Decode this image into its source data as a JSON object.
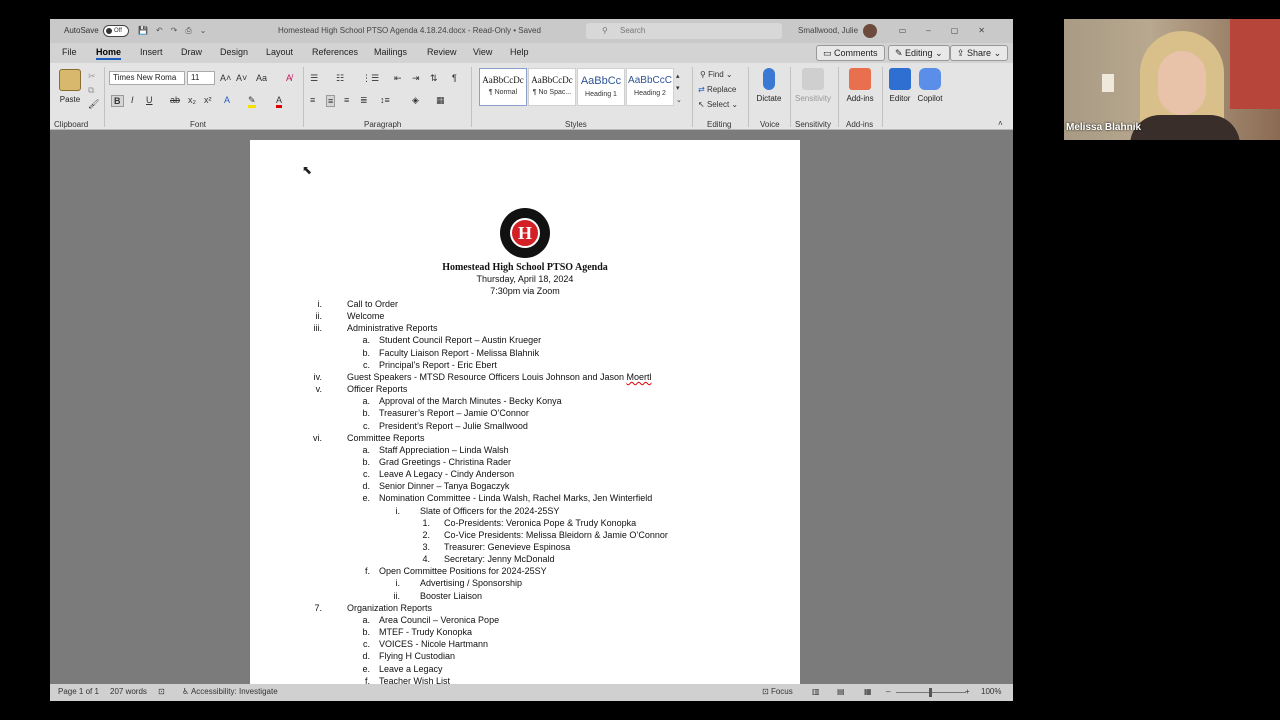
{
  "titlebar": {
    "autosave_label": "AutoSave",
    "autosave_state": "Off",
    "doc_title": "Homestead High School PTSO Agenda 4.18.24.docx  -  Read-Only  •  Saved",
    "search_placeholder": "Search",
    "user_name": "Smallwood, Julie"
  },
  "menu": {
    "tabs": [
      "File",
      "Home",
      "Insert",
      "Draw",
      "Design",
      "Layout",
      "References",
      "Mailings",
      "Review",
      "View",
      "Help"
    ],
    "comments": "Comments",
    "editing": "Editing",
    "share": "Share"
  },
  "ribbon": {
    "paste": "Paste",
    "font_name": "Times New Roma",
    "font_size": "11",
    "styles": [
      {
        "preview": "AaBbCcDc",
        "name": "¶ Normal"
      },
      {
        "preview": "AaBbCcDc",
        "name": "¶ No Spac..."
      },
      {
        "preview": "AaBbCc",
        "name": "Heading 1"
      },
      {
        "preview": "AaBbCcC",
        "name": "Heading 2"
      }
    ],
    "find": "Find",
    "replace": "Replace",
    "select": "Select",
    "dictate": "Dictate",
    "sensitivity": "Sensitivity",
    "addins": "Add-ins",
    "editor": "Editor",
    "copilot": "Copilot",
    "groups": {
      "clipboard": "Clipboard",
      "font": "Font",
      "paragraph": "Paragraph",
      "styles": "Styles",
      "editing": "Editing",
      "voice": "Voice",
      "sensitivity": "Sensitivity",
      "addins": "Add-ins"
    }
  },
  "doc": {
    "logo_letter": "H",
    "title": "Homestead High School PTSO Agenda",
    "date": "Thursday, April 18, 2024",
    "time": "7:30pm via Zoom",
    "items": [
      {
        "n": "i.",
        "t": "Call to Order"
      },
      {
        "n": "ii.",
        "t": "Welcome"
      },
      {
        "n": "iii.",
        "t": "Administrative Reports"
      },
      {
        "n": "a.",
        "t": "Student Council Report – Austin Krueger"
      },
      {
        "n": "b.",
        "t": "Faculty Liaison Report - Melissa Blahnik"
      },
      {
        "n": "c.",
        "t": "Principal’s Report - Eric Ebert"
      },
      {
        "n": "iv.",
        "t": "Guest Speakers - MTSD Resource Officers Louis Johnson and Jason ",
        "t2": "Moertl"
      },
      {
        "n": "v.",
        "t": "Officer Reports"
      },
      {
        "n": "a.",
        "t": "Approval of the March Minutes - Becky Konya"
      },
      {
        "n": "b.",
        "t": "Treasurer’s Report – Jamie O’Connor"
      },
      {
        "n": "c.",
        "t": "President’s Report – Julie Smallwood"
      },
      {
        "n": "vi.",
        "t": "Committee Reports"
      },
      {
        "n": "a.",
        "t": "Staff Appreciation – Linda Walsh"
      },
      {
        "n": "b.",
        "t": "Grad Greetings - Christina Rader"
      },
      {
        "n": "c.",
        "t": "Leave A Legacy - Cindy Anderson"
      },
      {
        "n": "d.",
        "t": "Senior Dinner – Tanya Bogaczyk"
      },
      {
        "n": "e.",
        "t": "Nomination Committee - Linda Walsh, Rachel Marks, Jen Winterfield"
      },
      {
        "n": "i.",
        "t": "Slate of Officers for the 2024-25SY"
      },
      {
        "n": "1.",
        "t": "Co-Presidents: Veronica Pope & Trudy Konopka"
      },
      {
        "n": "2.",
        "t": "Co-Vice Presidents: Melissa Bleidorn & Jamie O’Connor"
      },
      {
        "n": "3.",
        "t": "Treasurer: Genevieve Espinosa"
      },
      {
        "n": "4.",
        "t": "Secretary: Jenny McDonald"
      },
      {
        "n": "f.",
        "t": "Open Committee Positions for 2024-25SY"
      },
      {
        "n": "i.",
        "t": "Advertising / Sponsorship"
      },
      {
        "n": "ii.",
        "t": "Booster Liaison"
      },
      {
        "n": "7.",
        "t": "Organization Reports"
      },
      {
        "n": "a.",
        "t": "Area Council – Veronica Pope"
      },
      {
        "n": "b.",
        "t": "MTEF - Trudy Konopka"
      },
      {
        "n": "c.",
        "t": "VOICES - Nicole Hartmann"
      },
      {
        "n": "d.",
        "t": "Flying H Custodian"
      },
      {
        "n": "e.",
        "t": "Leave a Legacy"
      },
      {
        "n": "f.",
        "t": "Teacher Wish List"
      }
    ]
  },
  "status": {
    "page": "Page 1 of 1",
    "words": "207 words",
    "accessibility": "Accessibility: Investigate",
    "focus": "Focus",
    "zoom": "100%"
  },
  "webcam": {
    "name": "Melissa Blahnik"
  }
}
